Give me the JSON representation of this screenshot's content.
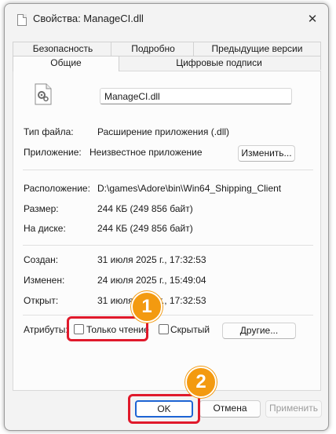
{
  "window": {
    "title": "Свойства: ManageCI.dll",
    "close_symbol": "✕"
  },
  "tabs": {
    "row_top": [
      "Безопасность",
      "Подробно",
      "Предыдущие версии"
    ],
    "row_bottom": [
      "Общие",
      "Цифровые подписи"
    ],
    "active": "Общие"
  },
  "general": {
    "file_name": "ManageCI.dll",
    "file_type_label": "Тип файла:",
    "file_type_value": "Расширение приложения (.dll)",
    "app_label": "Приложение:",
    "app_value": "Неизвестное приложение",
    "change_button": "Изменить...",
    "location_label": "Расположение:",
    "location_value": "D:\\games\\Adore\\bin\\Win64_Shipping_Client",
    "size_label": "Размер:",
    "size_value": "244 КБ (249 856 байт)",
    "disk_label": "На диске:",
    "disk_value": "244 КБ (249 856 байт)",
    "created_label": "Создан:",
    "created_value": "31 июля 2025 г., 17:32:53",
    "modified_label": "Изменен:",
    "modified_value": "24 июля 2025 г., 15:49:04",
    "opened_label": "Открыт:",
    "opened_value": "31 июля 2025 г., 17:32:53",
    "attributes_label": "Атрибуты:",
    "readonly_label": "Только чтение",
    "readonly_checked": false,
    "hidden_label": "Скрытый",
    "hidden_checked": false,
    "other_button": "Другие..."
  },
  "footer": {
    "ok": "OK",
    "cancel": "Отмена",
    "apply": "Применить"
  },
  "annotations": {
    "badge_1": "1",
    "badge_2": "2",
    "highlight_color": "#e0192b",
    "badge_color": "#f39a10"
  },
  "icons": [
    "file-icon",
    "close-icon",
    "dll-file-gear-icon"
  ]
}
